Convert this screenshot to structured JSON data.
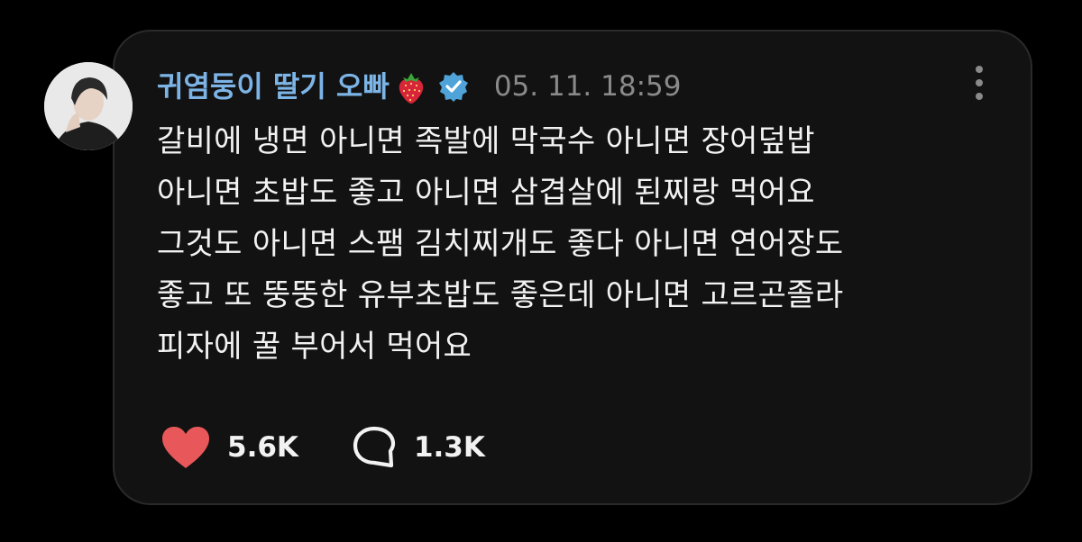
{
  "post": {
    "author_name": "귀염둥이 딸기 오빠",
    "timestamp": "05. 11. 18:59",
    "body_lines": [
      "갈비에 냉면 아니면 족발에 막국수 아니면 장어덮밥",
      "아니면 초밥도 좋고 아니면 삼겹살에 된찌랑 먹어요",
      "그것도 아니면 스팸 김치찌개도 좋다 아니면 연어장도",
      "좋고 또 뚱뚱한 유부초밥도 좋은데 아니면 고르곤졸라",
      "피자에 꿀 부어서 먹어요"
    ],
    "likes": "5.6K",
    "comments": "1.3K"
  },
  "icons": {
    "name_emoji": "strawberry-icon",
    "badge": "verified-icon",
    "menu": "more-vertical-icon",
    "like": "heart-icon",
    "comment": "comment-bubble-icon"
  },
  "colors": {
    "background": "#000000",
    "card": "#121212",
    "name": "#7db4e6",
    "timestamp": "#8a8a8a",
    "text": "#f2f2f2",
    "heart": "#e8585a",
    "verified": "#4fa3d9"
  }
}
